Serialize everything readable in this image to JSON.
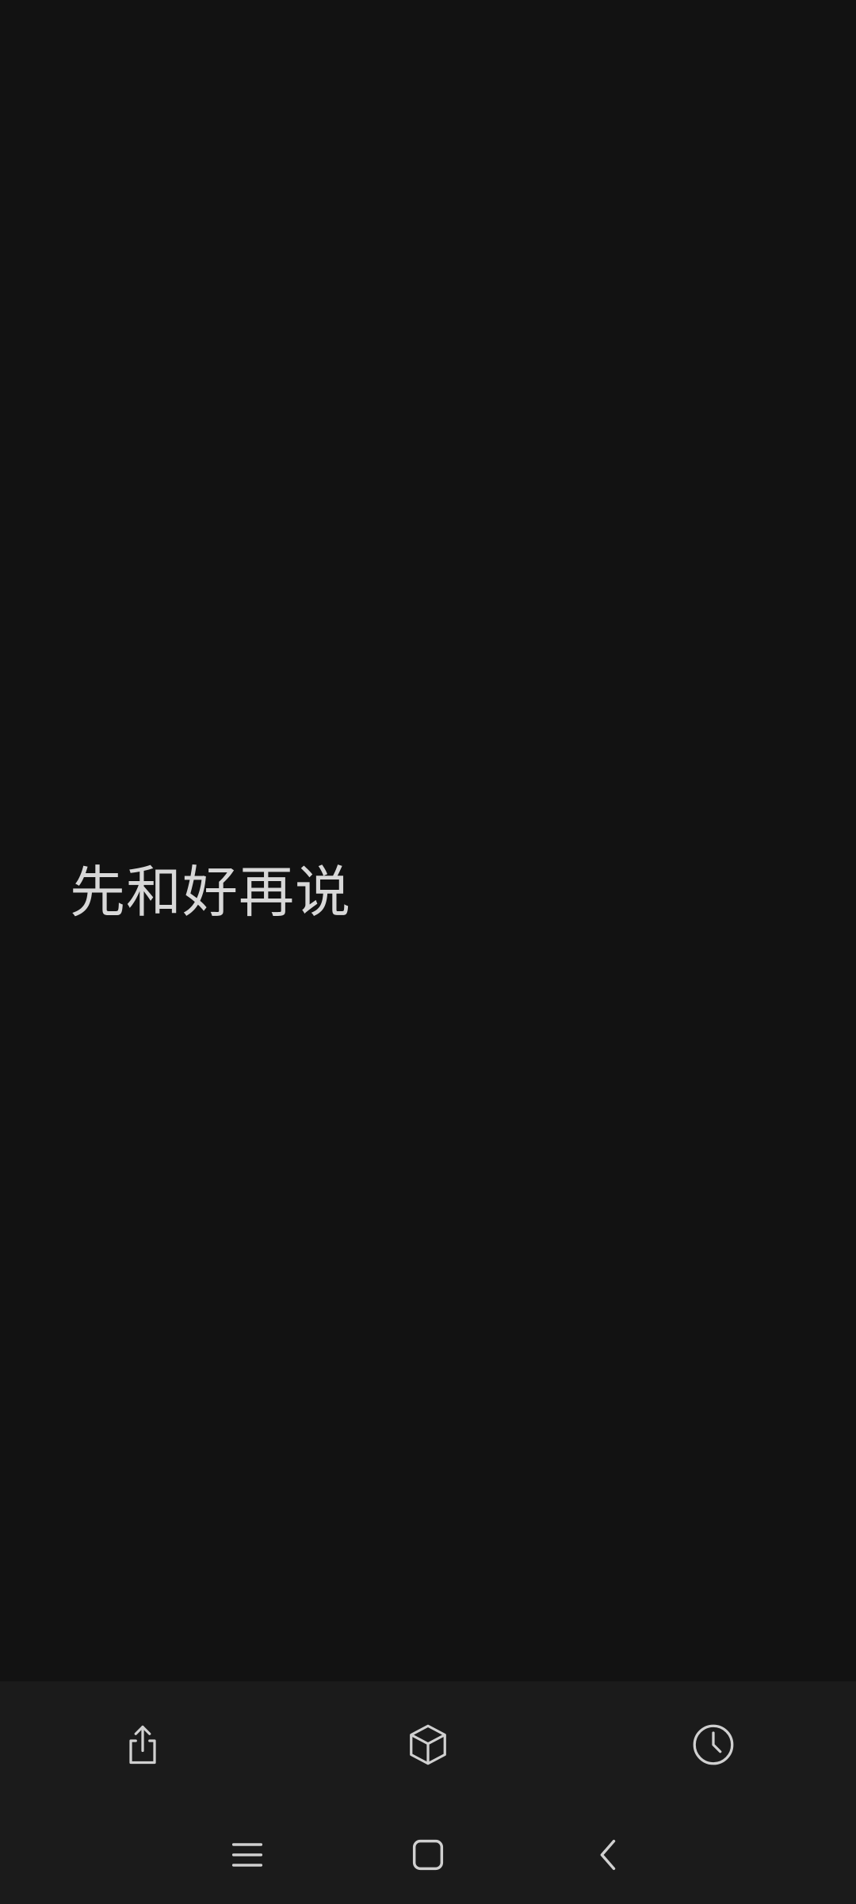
{
  "content": {
    "text": "先和好再说"
  },
  "toolbar": {
    "icons": [
      "share-icon",
      "cube-icon",
      "history-clock-icon"
    ]
  },
  "navbar": {
    "icons": [
      "recents-menu-icon",
      "home-square-icon",
      "back-chevron-icon"
    ]
  },
  "colors": {
    "background": "#121212",
    "bar_background": "#1b1b1b",
    "text": "#d8d8d8",
    "icon": "#d0d0d0"
  }
}
